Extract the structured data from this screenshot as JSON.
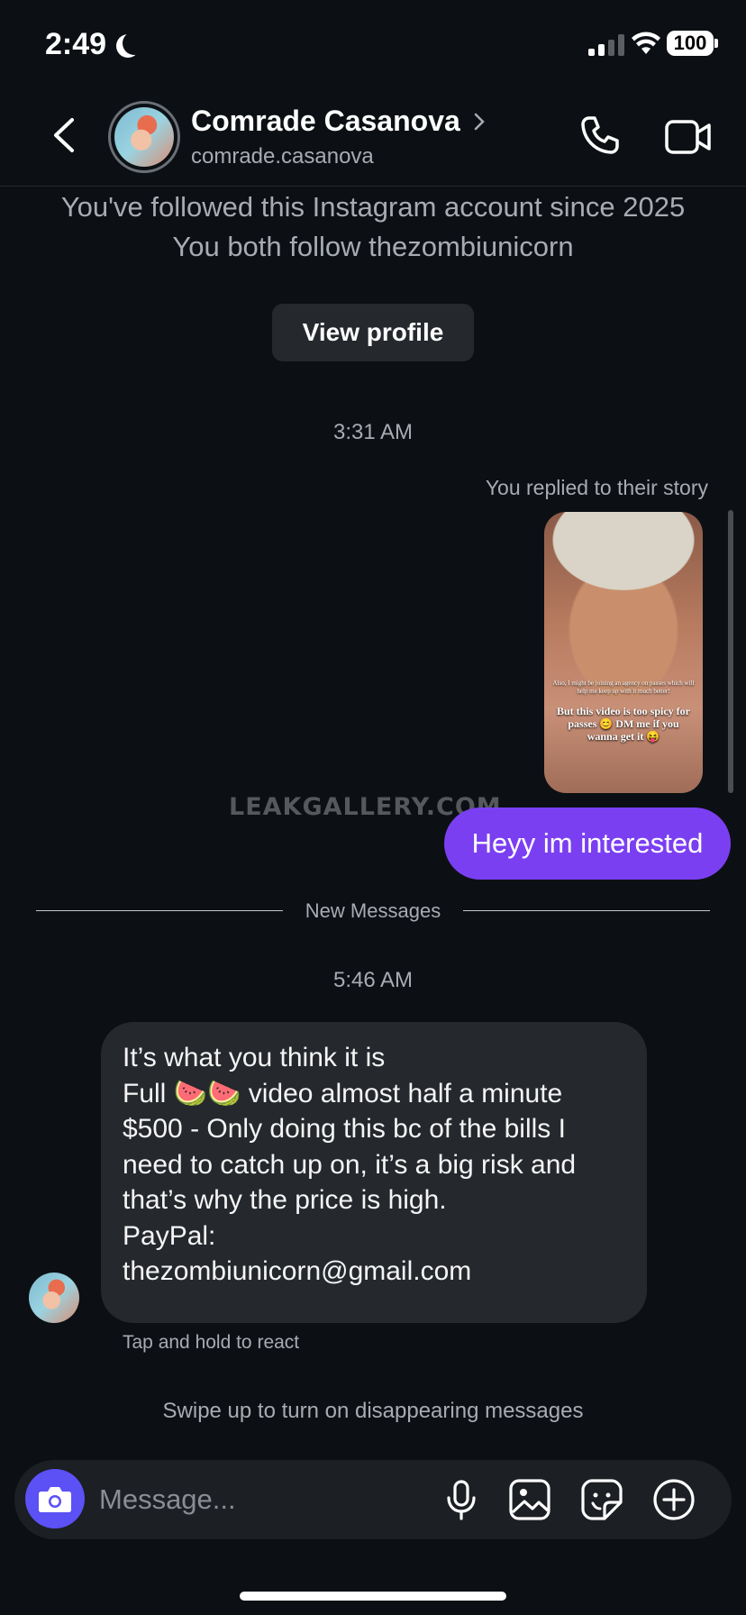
{
  "status_bar": {
    "time": "2:49",
    "battery": "100"
  },
  "header": {
    "display_name": "Comrade Casanova",
    "username": "comrade.casanova"
  },
  "profile_info": {
    "line1": "You've followed this Instagram account since 2025",
    "line2": "You both follow thezombiunicorn",
    "view_profile_label": "View profile"
  },
  "thread": {
    "timestamp1": "3:31 AM",
    "story_reply_label": "You replied to their story",
    "story_caption_small": "Also, I might be joining an agency on passes which will help me keep up with it much better!",
    "story_caption_big": "But this video is too spicy for passes 😊 DM me if you wanna get it 😝",
    "watermark": "LEAKGALLERY.COM",
    "sent_message": "Heyy im interested",
    "new_messages_label": "New Messages",
    "timestamp2": "5:46 AM",
    "received_message_lines": [
      "It’s what you think it is",
      "Full 🍉🍉 video almost half a minute",
      "$500 - Only doing this bc of the bills I",
      "need to catch up on, it’s a big risk and",
      "that’s why the price is high.",
      "PayPal:",
      "thezombiunicorn@gmail.com"
    ],
    "tap_hint": "Tap and hold to react",
    "disappearing_hint": "Swipe up to turn on disappearing messages"
  },
  "composer": {
    "placeholder": "Message..."
  },
  "colors": {
    "background": "#0c1014",
    "sent_bubble": "#7b3ff2",
    "received_bubble": "#25282d",
    "camera_button": "#5b51f5"
  }
}
